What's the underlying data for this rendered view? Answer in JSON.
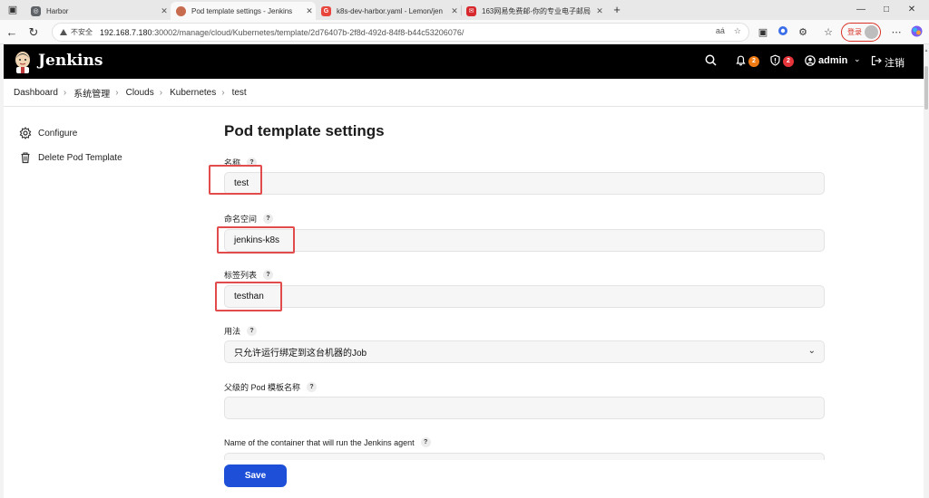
{
  "browser": {
    "tabs": [
      {
        "title": "Harbor",
        "favicon_color": "#5f6368"
      },
      {
        "title": "Pod template settings - Jenkins",
        "favicon_color": "#c76c4f"
      },
      {
        "title": "k8s-dev-harbor.yaml - Lemon/jen",
        "favicon_color": "#e8453c"
      },
      {
        "title": "163网易免费邮-你的专业电子邮局",
        "favicon_color": "#d6282d"
      }
    ],
    "new_tab": "+",
    "window_controls": [
      "—",
      "□",
      "✕"
    ],
    "security_label": "不安全",
    "url_host": "192.168.7.180",
    "url_path": ":30002/manage/cloud/Kubernetes/template/2d76407b-2f8d-492d-84f8-b44c53206076/",
    "translate_label": "aá",
    "login_label": "登录"
  },
  "header": {
    "brand": "Jenkins",
    "notifications_count": "2",
    "security_count": "2",
    "user": "admin",
    "logout": "注销",
    "notification_badge_color": "#f07b14",
    "security_badge_color": "#e5343a"
  },
  "breadcrumb": [
    "Dashboard",
    "系统管理",
    "Clouds",
    "Kubernetes",
    "test"
  ],
  "sidebar": [
    {
      "label": "Configure",
      "icon": "gear-icon"
    },
    {
      "label": "Delete Pod Template",
      "icon": "trash-icon"
    }
  ],
  "page_title": "Pod template settings",
  "fields": {
    "name": {
      "label": "名称",
      "value": "test",
      "help": "?"
    },
    "namespace": {
      "label": "命名空间",
      "value": "jenkins-k8s",
      "help": "?"
    },
    "labels": {
      "label": "标签列表",
      "value": "testhan",
      "help": "?"
    },
    "usage": {
      "label": "用法",
      "value": "只允许运行绑定到这台机器的Job",
      "help": "?"
    },
    "parent": {
      "label": "父级的 Pod 模板名称",
      "value": "",
      "help": "?"
    },
    "container": {
      "label": "Name of the container that will run the Jenkins agent",
      "help": "?"
    }
  },
  "save_label": "Save",
  "highlight_color": "#e24b4b",
  "accent_color": "#1d4fd8"
}
